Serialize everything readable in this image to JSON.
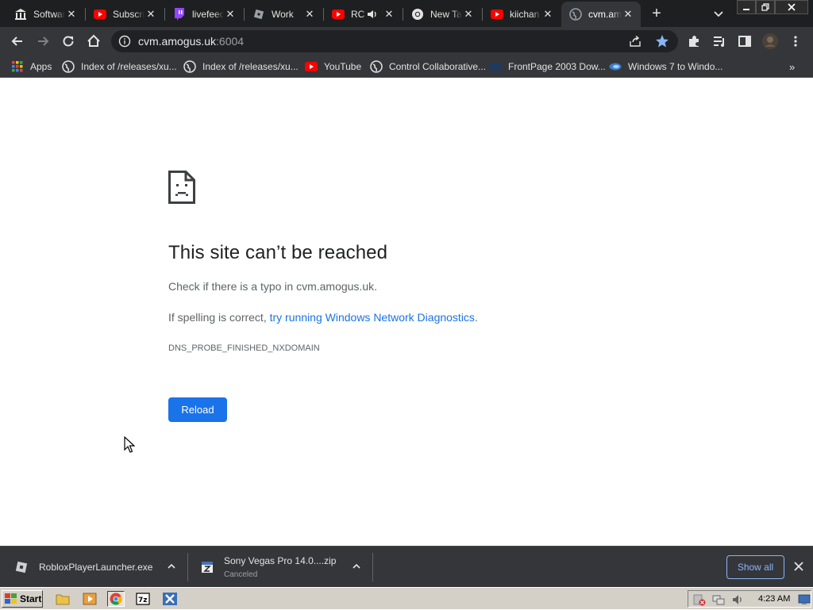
{
  "tabs": [
    {
      "title": "Software",
      "icon": "museum-icon"
    },
    {
      "title": "Subscriptions",
      "icon": "youtube-icon"
    },
    {
      "title": "livefeed",
      "icon": "twitch-icon"
    },
    {
      "title": "Work",
      "icon": "roblox-icon"
    },
    {
      "title": "RC",
      "icon": "youtube-icon",
      "audio": true
    },
    {
      "title": "New Tab",
      "icon": "chrome-icon"
    },
    {
      "title": "kiichan",
      "icon": "youtube-icon"
    },
    {
      "title": "cvm.amogus.uk",
      "icon": "globe-icon",
      "active": true
    }
  ],
  "address_bar": {
    "host": "cvm.amogus.uk",
    "port": ":6004"
  },
  "bookmarks": [
    {
      "label": "Apps",
      "icon": "apps-grid-icon"
    },
    {
      "label": "Index of /releases/xu...",
      "icon": "globe-icon"
    },
    {
      "label": "Index of /releases/xu...",
      "icon": "globe-icon"
    },
    {
      "label": "YouTube",
      "icon": "youtube-icon"
    },
    {
      "label": "Control Collaborative...",
      "icon": "globe-icon"
    },
    {
      "label": "FrontPage 2003 Dow...",
      "icon": "frontpage-icon"
    },
    {
      "label": "Windows 7 to Windo...",
      "icon": "windows-icon"
    }
  ],
  "error_page": {
    "title": "This site can’t be reached",
    "typo_prefix": "Check if there is a typo in ",
    "typo_host": "cvm.amogus.uk",
    "typo_suffix": ".",
    "diag_prefix": "If spelling is correct, ",
    "diag_link": "try running Windows Network Diagnostics",
    "diag_suffix": ".",
    "error_code": "DNS_PROBE_FINISHED_NXDOMAIN",
    "reload_label": "Reload"
  },
  "downloads": [
    {
      "name": "RobloxPlayerLauncher.exe",
      "status": "",
      "icon": "exe-file-icon"
    },
    {
      "name": "Sony Vegas Pro 14.0....zip",
      "status": "Canceled",
      "icon": "zip-file-icon"
    }
  ],
  "download_shelf": {
    "show_all_label": "Show all"
  },
  "taskbar": {
    "start_label": "Start",
    "clock": "4:23 AM"
  },
  "colors": {
    "link": "#1a73e8",
    "button": "#1a73e8",
    "tab_strip": "#1e1f20",
    "toolbar": "#35363a",
    "taskbar": "#d4d0c8"
  }
}
